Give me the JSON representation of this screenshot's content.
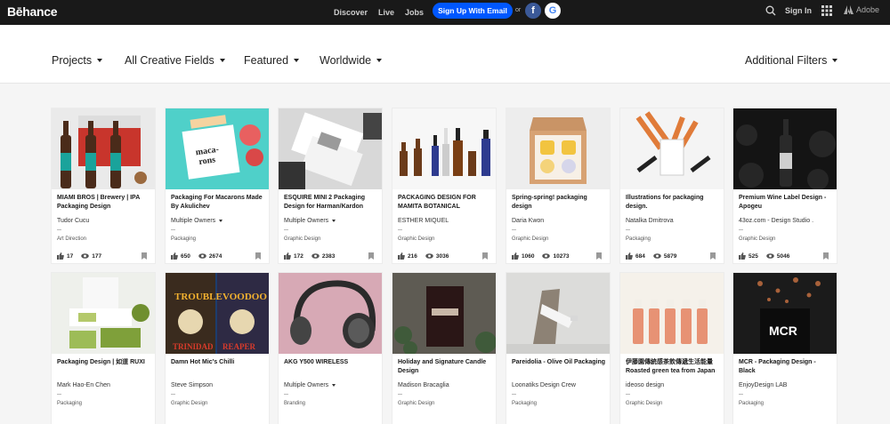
{
  "header": {
    "logo": "Bēhance",
    "nav": [
      "Discover",
      "Live",
      "Jobs"
    ],
    "signup_label": "Sign Up With Email",
    "or_label": "or",
    "facebook_glyph": "f",
    "google_glyph": "G",
    "signin_label": "Sign In",
    "adobe_label": "Adobe",
    "icons": [
      "search-icon",
      "apps-grid-icon",
      "adobe-logo-icon"
    ]
  },
  "filters": {
    "projects": "Projects",
    "fields": "All Creative Fields",
    "featured": "Featured",
    "worldwide": "Worldwide",
    "additional": "Additional Filters"
  },
  "projects": [
    {
      "title": "MIAMI BROS | Brewery | IPA Packaging Design",
      "owner": "Tudor Cucu",
      "multi": false,
      "field": "Art Direction",
      "likes": "17",
      "views": "177",
      "thumb": "beer-bottles",
      "bg": "#e9e9e9"
    },
    {
      "title": "Packaging For Macarons Made By Akulichev",
      "owner": "Multiple Owners",
      "multi": true,
      "field": "Packaging",
      "likes": "650",
      "views": "2674",
      "thumb": "macarons-box",
      "bg": "#4fd0c9"
    },
    {
      "title": "ESQUIRE MINI 2 Packaging Design for Harman/Kardon",
      "owner": "Multiple Owners",
      "multi": true,
      "field": "Graphic Design",
      "likes": "172",
      "views": "2383",
      "thumb": "speaker-boxes",
      "bg": "#d6d6d6"
    },
    {
      "title": "PACKAGING DESIGN FOR MAMITA BOTANICAL",
      "owner": "ESTHER MIQUEL",
      "multi": false,
      "field": "Graphic Design",
      "likes": "216",
      "views": "3036",
      "thumb": "botanical-bottles",
      "bg": "#f6f6f6"
    },
    {
      "title": "Spring-spring! packaging design",
      "owner": "Daria Kwon",
      "multi": false,
      "field": "Graphic Design",
      "likes": "1060",
      "views": "10273",
      "thumb": "spring-box",
      "bg": "#eeeeee"
    },
    {
      "title": "Illustrations for packaging design.",
      "owner": "Natalka Dmitrova",
      "multi": false,
      "field": "Packaging",
      "likes": "684",
      "views": "5879",
      "thumb": "illustrated-bags",
      "bg": "#f4f4f4"
    },
    {
      "title": "Premium Wine Label Design - Apogeu",
      "owner": "43oz.com - Design Studio .",
      "multi": false,
      "field": "Graphic Design",
      "likes": "525",
      "views": "5046",
      "thumb": "wine-bottle",
      "bg": "#141414"
    },
    {
      "title": "Packaging Design | 如道 RUXI",
      "owner": "Mark Hao-En Chen",
      "multi": false,
      "field": "Packaging",
      "likes": "",
      "views": "",
      "thumb": "matcha-boxes",
      "bg": "#e8ece4"
    },
    {
      "title": "Damn Hot Mic's Chilli",
      "owner": "Steve Simpson",
      "multi": false,
      "field": "Graphic Design",
      "likes": "",
      "views": "",
      "thumb": "chilli-sauce",
      "bg": "#1d3c6d"
    },
    {
      "title": "AKG Y500 WIRELESS",
      "owner": "Multiple Owners",
      "multi": true,
      "field": "Branding",
      "likes": "",
      "views": "",
      "thumb": "headphones",
      "bg": "#d4a7b4"
    },
    {
      "title": "Holiday and Signature Candle Design",
      "owner": "Madison Bracaglia",
      "multi": false,
      "field": "Graphic Design",
      "likes": "",
      "views": "",
      "thumb": "candle",
      "bg": "#6d6a62"
    },
    {
      "title": "Pareidolia - Olive Oil Packaging",
      "owner": "Loonatiks Design Crew",
      "multi": false,
      "field": "Packaging",
      "likes": "",
      "views": "",
      "thumb": "olive-oil",
      "bg": "#d9d9d7"
    },
    {
      "title": "伊藤園傳統感茶飲傳遞生活能量 Roasted green tea from Japan",
      "owner": "ideoso design",
      "multi": false,
      "field": "Graphic Design",
      "likes": "",
      "views": "",
      "thumb": "tea-bottles",
      "bg": "#f3efe9"
    },
    {
      "title": "MCR - Packaging Design - Black",
      "owner": "EnjoyDesign LAB",
      "multi": false,
      "field": "Packaging",
      "likes": "",
      "views": "",
      "thumb": "coffee-bag",
      "bg": "#1b1b1b"
    }
  ]
}
